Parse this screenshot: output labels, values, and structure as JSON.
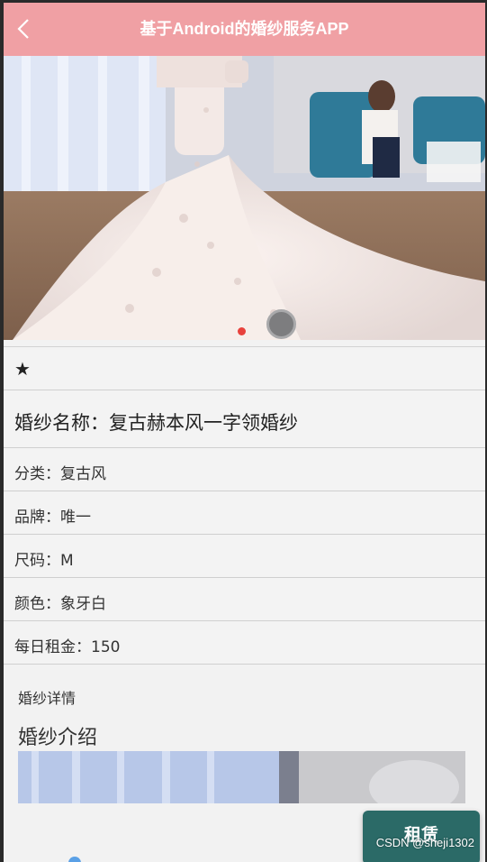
{
  "header": {
    "title": "基于Android的婚纱服务APP"
  },
  "icons": {
    "back": "back-arrow-icon",
    "favorite": "star-icon"
  },
  "favorite": {
    "glyph": "★"
  },
  "dress": {
    "name_line": "婚纱名称：复古赫本风一字领婚纱",
    "attributes": [
      {
        "text": "分类：复古风"
      },
      {
        "text": "品牌：唯一"
      },
      {
        "text": "尺码：M"
      },
      {
        "text": "颜色：象牙白"
      },
      {
        "text": "每日租金：150"
      }
    ]
  },
  "detail": {
    "section_label": "婚纱详情",
    "intro_title": "婚纱介绍"
  },
  "actions": {
    "rent_label": "租赁"
  },
  "watermark": "CSDN @sheji1302",
  "colors": {
    "header": "#f0a0a4",
    "rent_button": "#2b6a67",
    "active_dot": "#e8413c"
  }
}
